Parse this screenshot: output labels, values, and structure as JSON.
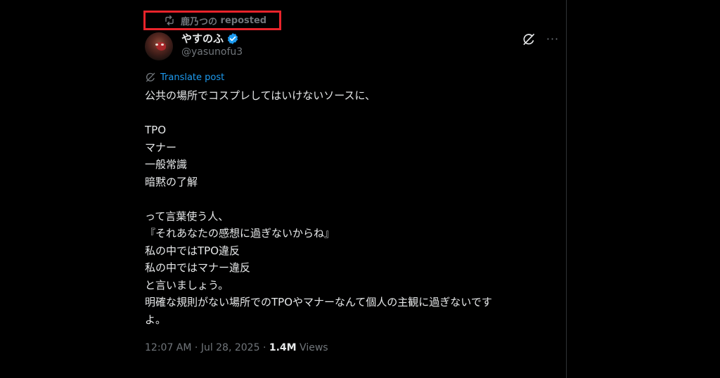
{
  "repost": {
    "user": "鹿乃つの",
    "label": "reposted"
  },
  "author": {
    "display_name": "やすのふ",
    "handle": "@yasunofu3",
    "verified": true
  },
  "icons": {
    "repost": "repost-icon",
    "verified": "verified-badge-icon",
    "grok": "grok-icon",
    "more": "more-icon",
    "translate": "translate-icon"
  },
  "translate": {
    "label": "Translate post"
  },
  "post": {
    "lines": [
      "公共の場所でコスプレしてはいけないソースに、",
      "",
      "TPO",
      "マナー",
      "一般常識",
      "暗黙の了解",
      "",
      "って言葉使う人、",
      "『それあなたの感想に過ぎないからね』",
      "私の中ではTPO違反",
      "私の中ではマナー違反",
      "と言いましょう。",
      "明確な規則がない場所でのTPOやマナーなんて個人の主観に過ぎないです",
      "よ。"
    ]
  },
  "meta": {
    "time": "12:07 AM",
    "separator": " · ",
    "date": "Jul 28, 2025",
    "separator2": " · ",
    "views_count": "1.4M",
    "views_label": " Views"
  },
  "colors": {
    "background": "#000000",
    "text": "#e7e9ea",
    "muted": "#71767b",
    "accent": "#1d9bf0",
    "highlight_box": "#e8242b"
  }
}
